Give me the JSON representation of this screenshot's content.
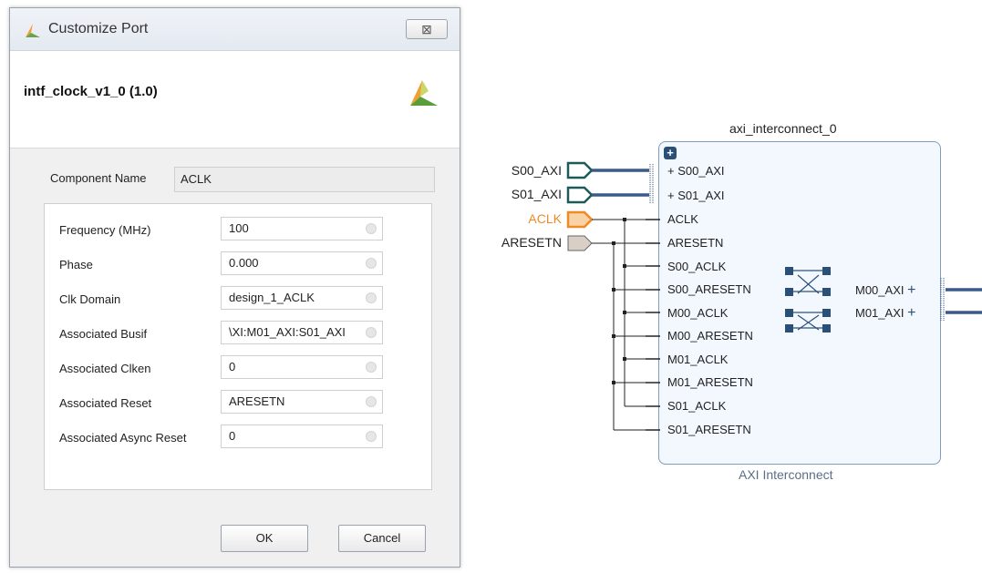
{
  "dialog": {
    "title": "Customize Port",
    "close_label": "⊠",
    "ip_title": "intf_clock_v1_0 (1.0)",
    "component_name_label": "Component Name",
    "component_name_value": "ACLK",
    "params": [
      {
        "label": "Frequency (MHz)",
        "value": "100"
      },
      {
        "label": "Phase",
        "value": "0.000"
      },
      {
        "label": "Clk Domain",
        "value": "design_1_ACLK"
      },
      {
        "label": "Associated Busif",
        "value": "\\XI:M01_AXI:S01_AXI"
      },
      {
        "label": "Associated Clken",
        "value": "0"
      },
      {
        "label": "Associated Reset",
        "value": "ARESETN"
      },
      {
        "label": "Associated Async Reset",
        "value": "0"
      }
    ],
    "ok_label": "OK",
    "cancel_label": "Cancel"
  },
  "diagram": {
    "instance_name": "axi_interconnect_0",
    "instance_type": "AXI Interconnect",
    "external_ports": [
      {
        "name": "S00_AXI",
        "kind": "bus"
      },
      {
        "name": "S01_AXI",
        "kind": "bus"
      },
      {
        "name": "ACLK",
        "kind": "clock",
        "selected": true
      },
      {
        "name": "ARESETN",
        "kind": "reset"
      }
    ],
    "bus_pin_prefix": "+",
    "input_pins": [
      "S00_AXI",
      "S01_AXI",
      "ACLK",
      "ARESETN",
      "S00_ACLK",
      "S00_ARESETN",
      "M00_ACLK",
      "M00_ARESETN",
      "M01_ACLK",
      "M01_ARESETN",
      "S01_ACLK",
      "S01_ARESETN"
    ],
    "output_pins": [
      "M00_AXI",
      "M01_AXI"
    ],
    "output_pin_suffix": "+"
  },
  "colors": {
    "bus": "#3a5a8c",
    "selected_port": "#f08a24",
    "reset_port": "#d9cfc5",
    "bus_port": "#1f5a5a",
    "wire": "#222222"
  }
}
